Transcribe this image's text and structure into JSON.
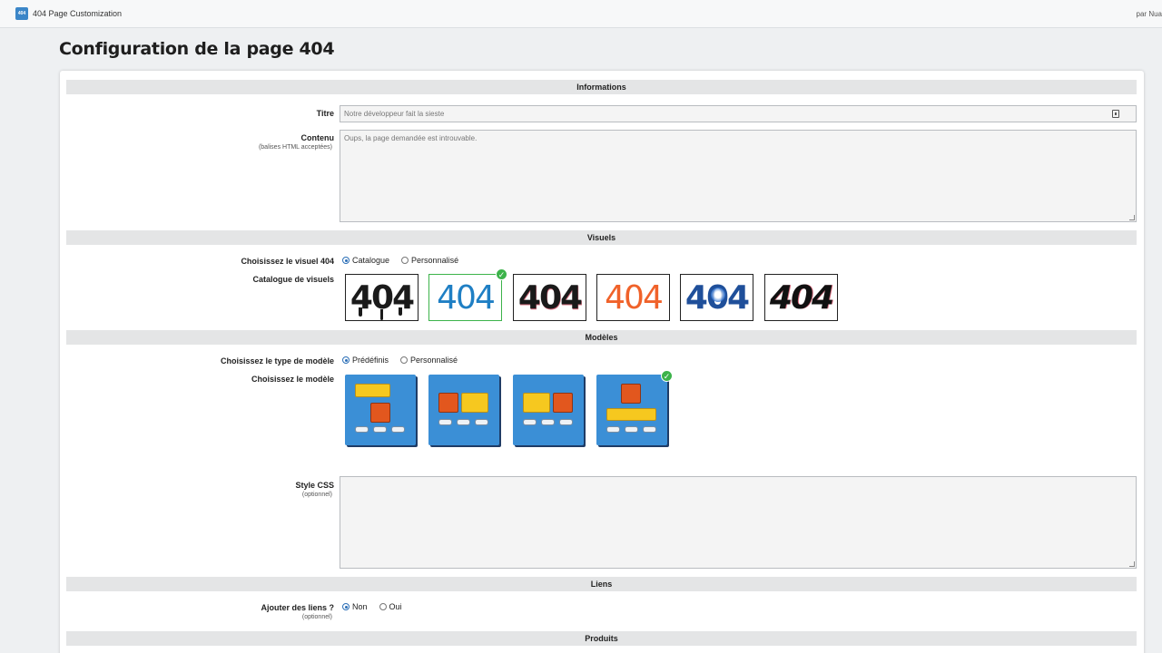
{
  "app": {
    "icon_label": "404",
    "title": "404 Page Customization",
    "author": "par Nua"
  },
  "page": {
    "title": "Configuration de la page 404"
  },
  "sections": {
    "informations": "Informations",
    "visuels": "Visuels",
    "modeles": "Modèles",
    "liens": "Liens",
    "produits": "Produits"
  },
  "fields": {
    "titre_label": "Titre",
    "titre_value": "Notre développeur fait la sieste",
    "contenu_label": "Contenu",
    "contenu_sublabel": "(balises HTML acceptées)",
    "contenu_value": "Oups, la page demandée est introuvable.",
    "visuel_label": "Choisissez le visuel 404",
    "visuel_options": [
      "Catalogue",
      "Personnalisé"
    ],
    "visuel_selected": "Catalogue",
    "catalogue_label": "Catalogue de visuels",
    "modele_type_label": "Choisissez le type de modèle",
    "modele_type_options": [
      "Prédéfinis",
      "Personnalisé"
    ],
    "modele_type_selected": "Prédéfinis",
    "modele_label": "Choisissez le modèle",
    "css_label": "Style CSS",
    "css_sublabel": "(optionnel)",
    "css_value": "",
    "liens_label": "Ajouter des liens ?",
    "liens_sublabel": "(optionnel)",
    "liens_options": [
      "Non",
      "Oui"
    ],
    "liens_selected": "Non"
  },
  "visuals": [
    {
      "text": "404",
      "style": "drip",
      "color": "#1a1a1a",
      "selected": false
    },
    {
      "text": "404",
      "style": "globe",
      "color": "#1f7fc4",
      "selected": true
    },
    {
      "text": "404",
      "style": "glitch",
      "color": "#1a1a1a",
      "selected": false
    },
    {
      "text": "404",
      "style": "flat",
      "color": "#f0622a",
      "selected": false
    },
    {
      "text": "404",
      "style": "paint",
      "color": "#1f4f9a",
      "selected": false
    },
    {
      "text": "404",
      "style": "glitch-italic",
      "color": "#111111",
      "selected": false
    }
  ],
  "models": [
    {
      "layout": "yellow-top-orange-bottom",
      "selected": false
    },
    {
      "layout": "orange-left-yellow-right",
      "selected": false
    },
    {
      "layout": "yellow-left-orange-right",
      "selected": false
    },
    {
      "layout": "orange-top-yellow-bottom",
      "selected": true
    }
  ],
  "model_button_label": "file"
}
